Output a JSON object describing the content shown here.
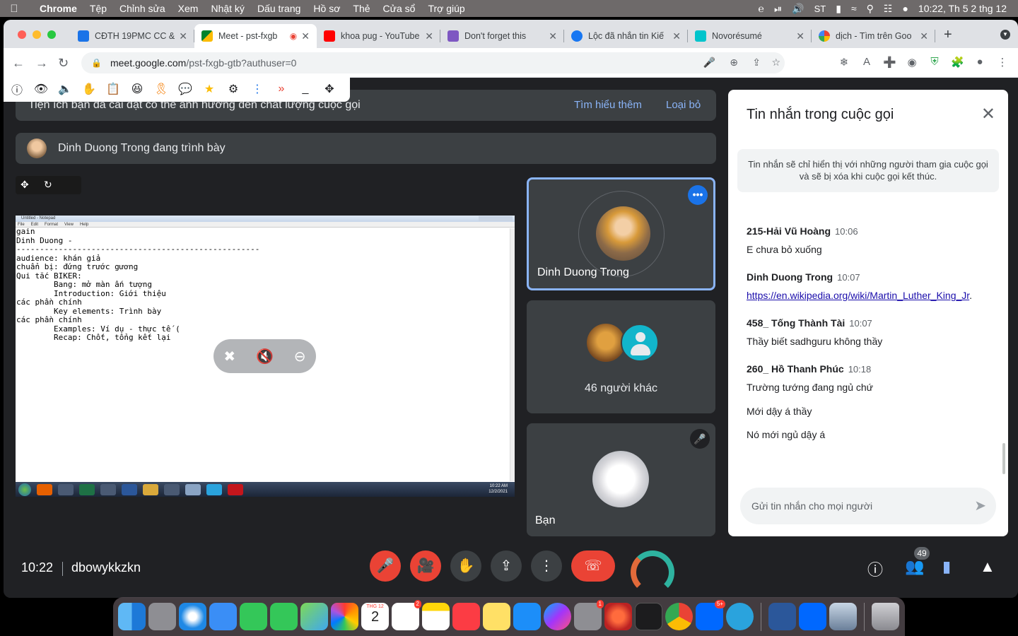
{
  "menubar": {
    "items": [
      "Chrome",
      "Tệp",
      "Chỉnh sửa",
      "Xem",
      "Nhật ký",
      "Dấu trang",
      "Hồ sơ",
      "Thẻ",
      "Cửa sổ",
      "Trợ giúp"
    ],
    "datetime": "10:22, Th 5 2 thg 12",
    "status_badge": "ST"
  },
  "tabs": [
    {
      "title": "CĐTH 19PMC CC &",
      "color": "#1a73e8"
    },
    {
      "title": "Meet - pst-fxgb",
      "color": "#00897b"
    },
    {
      "title": "khoa pug - YouTube",
      "color": "#ff0000"
    },
    {
      "title": "Don't forget this",
      "color": "#7e57c2"
    },
    {
      "title": "Lộc đã nhắn tin Kiế",
      "color": "#1877f2"
    },
    {
      "title": "Novorésumé",
      "color": "#00c4cc"
    },
    {
      "title": "dịch - Tìm trên Goo",
      "color": "#4285f4"
    }
  ],
  "address": {
    "host": "meet.google.com",
    "path": "/pst-fxgb-gtb?authuser=0"
  },
  "banner": {
    "text": "Tiện ích bạn đã cài đặt có thể ảnh hưởng đến chất lượng cuộc gọi",
    "learn_more": "Tìm hiểu thêm",
    "dismiss": "Loại bỏ"
  },
  "presenting": {
    "text": "Dinh Duong Trong đang trình bày"
  },
  "notepad": {
    "title": "Untitled - Notepad",
    "menu": [
      "File",
      "Edit",
      "Format",
      "View",
      "Help"
    ],
    "lines": [
      "gain",
      "",
      "Dinh Duong -",
      "",
      "----------------------------------------------------",
      "audience: khán giả",
      "chuẩn bị: đứng trước gương",
      "Qui tắc BIKER:",
      "        Bang: mở màn ấn tượng",
      "        Introduction: Giới thiệu",
      "các phần chính",
      "        Key elements: Trình bày",
      "các phần chính",
      "        Examples: Ví dụ - thực tế (",
      "        Recap: Chốt, tổng kết lại"
    ],
    "clock_time": "10:22 AM",
    "clock_date": "12/2/2021"
  },
  "tiles": {
    "presenter": {
      "name": "Dinh Duong Trong"
    },
    "others": {
      "label": "46 người khác"
    },
    "self": {
      "name": "Bạn"
    }
  },
  "chat": {
    "header": "Tin nhắn trong cuộc gọi",
    "note": "Tin nhắn sẽ chỉ hiển thị với những người tham gia cuộc gọi và sẽ bị xóa khi cuộc gọi kết thúc.",
    "messages": [
      {
        "sender": "215-Hải Vũ Hoàng",
        "time": "10:06",
        "text": "E chưa bỏ xuống"
      },
      {
        "sender": "Dinh Duong Trong",
        "time": "10:07",
        "text": "https://en.wikipedia.org/wiki/Martin_Luther_King_Jr",
        "suffix": "."
      },
      {
        "sender": "458_ Tống Thành Tài",
        "time": "10:07",
        "text": "Thầy biết sadhguru không thầy"
      },
      {
        "sender": "260_ Hồ Thanh Phúc",
        "time": "10:18",
        "text": "Trường tướng đang ngủ chứ",
        "extra": [
          "Mới dậy á thầy",
          "Nó mới ngủ dậy á"
        ]
      }
    ],
    "input_placeholder": "Gửi tin nhắn cho mọi người"
  },
  "bottombar": {
    "time": "10:22",
    "meeting_code": "dbowykkzkn",
    "participants_count": "49"
  },
  "dock": {
    "calendar_month": "THG 12",
    "calendar_day": "2",
    "reminders_badge": "2",
    "settings_badge": "1",
    "zalo_badge": "5+"
  }
}
